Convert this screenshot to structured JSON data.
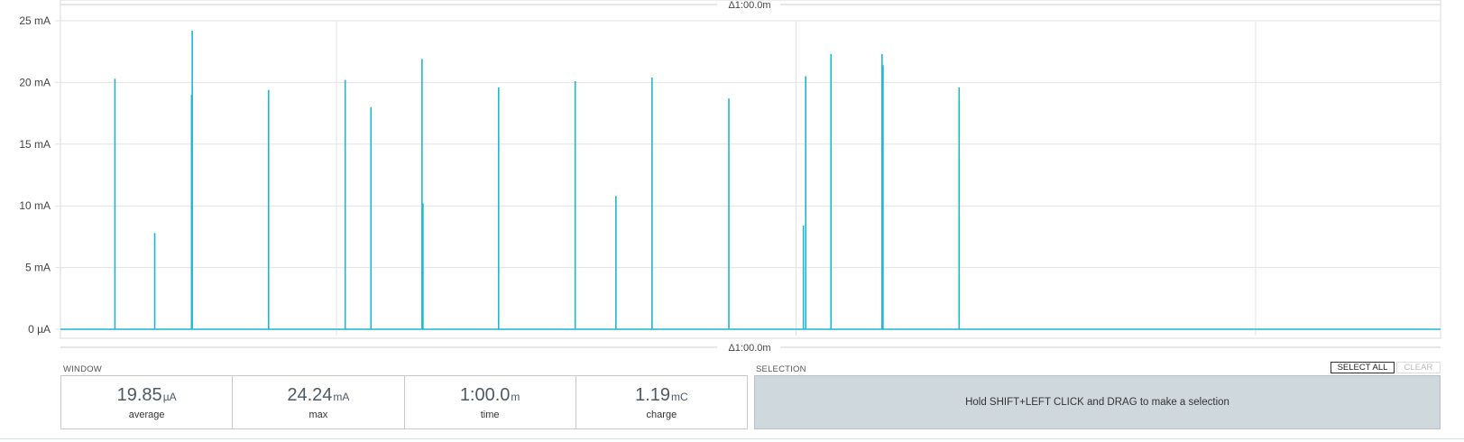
{
  "chart_data": {
    "type": "line",
    "title": "",
    "xlabel": "",
    "ylabel": "",
    "y_ticks": [
      "0 µA",
      "5 mA",
      "10 mA",
      "15 mA",
      "20 mA",
      "25 mA"
    ],
    "y_tick_values_mA": [
      0,
      5,
      10,
      15,
      20,
      25
    ],
    "ylim_mA": [
      0,
      25
    ],
    "x_window_label_top": "Δ1:00.0m",
    "x_window_label_bottom": "Δ1:00.0m",
    "x_span_seconds": 60,
    "grid": true,
    "series": [
      {
        "color": "#1fb6d1",
        "baseline_mA": 0,
        "spikes": [
          {
            "t": 2.37,
            "mA": 20.3
          },
          {
            "t": 4.1,
            "mA": 7.8
          },
          {
            "t": 5.7,
            "mA": 19.0
          },
          {
            "t": 5.73,
            "mA": 24.2
          },
          {
            "t": 9.05,
            "mA": 19.4
          },
          {
            "t": 12.38,
            "mA": 20.2
          },
          {
            "t": 13.5,
            "mA": 18.0
          },
          {
            "t": 15.72,
            "mA": 21.9
          },
          {
            "t": 15.76,
            "mA": 10.2
          },
          {
            "t": 19.05,
            "mA": 19.6
          },
          {
            "t": 22.38,
            "mA": 20.1
          },
          {
            "t": 24.15,
            "mA": 10.8
          },
          {
            "t": 25.72,
            "mA": 20.4
          },
          {
            "t": 29.06,
            "mA": 18.7
          },
          {
            "t": 32.3,
            "mA": 8.4
          },
          {
            "t": 32.4,
            "mA": 20.5
          },
          {
            "t": 33.5,
            "mA": 22.3
          },
          {
            "t": 35.72,
            "mA": 22.3
          },
          {
            "t": 35.76,
            "mA": 21.4
          },
          {
            "t": 39.07,
            "mA": 19.6
          }
        ]
      }
    ]
  },
  "window": {
    "label": "WINDOW",
    "stats": [
      {
        "value": "19.85",
        "unit": "µA",
        "name": "average"
      },
      {
        "value": "24.24",
        "unit": "mA",
        "name": "max"
      },
      {
        "value": "1:00.0",
        "unit": "m",
        "name": "time"
      },
      {
        "value": "1.19",
        "unit": "mC",
        "name": "charge"
      }
    ]
  },
  "selection": {
    "label": "SELECTION",
    "hint": "Hold SHIFT+LEFT CLICK and DRAG to make a selection",
    "select_all_label": "SELECT ALL",
    "clear_label": "CLEAR"
  },
  "colors": {
    "trace": "#1fb6d1",
    "selection_bg": "#cfd8dc",
    "grid": "#e3e3e3"
  }
}
